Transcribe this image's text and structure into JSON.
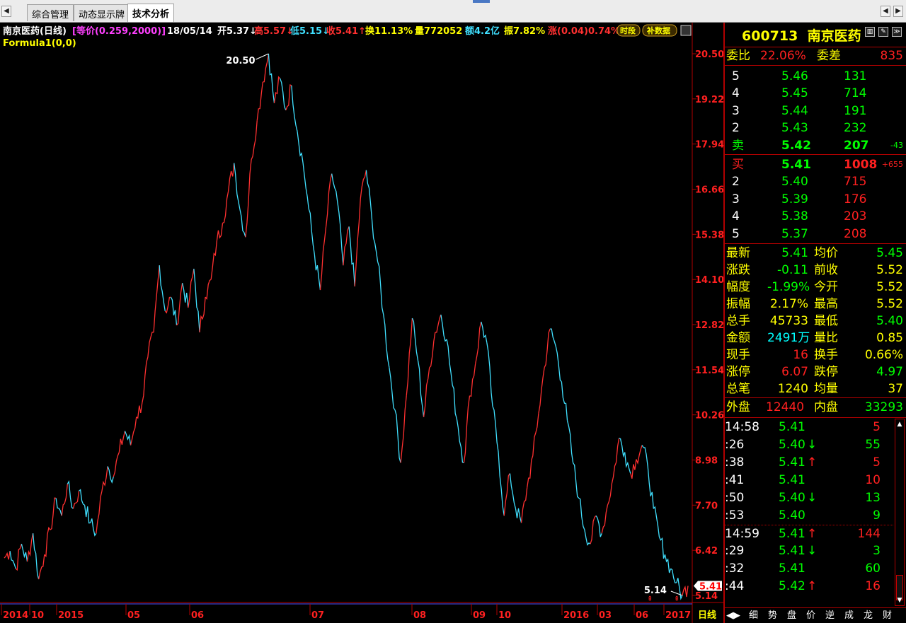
{
  "tabs": {
    "items": [
      "综合管理",
      "动态显示牌",
      "技术分析"
    ],
    "active_index": 2
  },
  "header": {
    "name": "南京医药(日线)",
    "adjust": "[等价(0.259,2000)]",
    "date": "18/05/14",
    "open": "开5.37↓",
    "high": "高5.57↓",
    "low": "低5.15↓",
    "close": "收5.41↑",
    "turnover": "换11.13%",
    "volume": "量772052",
    "amount": "额4.2亿",
    "amplitude": "振7.82%",
    "change": "涨(0.04)0.74%",
    "btn_period": "时段",
    "btn_supp": "补数据"
  },
  "formula": "Formula1(0,0)",
  "period_label": "日线",
  "chart_data": {
    "type": "line",
    "title": "南京医药(日线)",
    "ylim": [
      5.14,
      20.5
    ],
    "y_ticks": [
      "20.50",
      "19.22",
      "17.94",
      "16.66",
      "15.38",
      "14.10",
      "12.82",
      "11.54",
      "10.26",
      "8.98",
      "7.70",
      "6.42",
      "5.14"
    ],
    "x_labels": [
      "2014",
      "10",
      "2015",
      "05",
      "06",
      "07",
      "08",
      "09",
      "10",
      "2016",
      "03",
      "06",
      "2017"
    ],
    "max_label": "20.50",
    "min_label": "5.14",
    "last_label": "5.41",
    "series": [
      {
        "values": [
          6.2,
          6.4,
          5.9,
          6.6,
          6.1,
          6.9,
          5.6,
          6.3,
          7.0,
          7.9,
          7.4,
          8.3,
          7.6,
          8.1,
          7.7,
          7.2,
          6.9,
          8.1,
          8.8,
          8.5,
          9.2,
          9.8,
          9.4,
          10.2,
          10.6,
          11.9,
          12.6,
          14.5,
          13.2,
          13.6,
          12.8,
          14.0,
          13.3,
          14.4,
          12.6,
          13.6,
          14.1,
          15.2,
          15.7,
          16.6,
          17.4,
          16.1,
          15.3,
          17.5,
          18.6,
          19.7,
          20.5,
          19.1,
          19.8,
          18.9,
          19.6,
          18.3,
          17.4,
          16.1,
          14.8,
          13.8,
          15.6,
          17.1,
          16.3,
          14.5,
          15.6,
          13.9,
          16.4,
          17.2,
          15.8,
          14.6,
          13.1,
          11.6,
          10.4,
          8.9,
          10.8,
          13.0,
          11.8,
          10.2,
          11.6,
          12.6,
          13.1,
          12.4,
          11.1,
          9.9,
          8.9,
          10.8,
          11.7,
          12.9,
          12.3,
          10.5,
          9.2,
          7.4,
          8.6,
          7.6,
          7.2,
          8.2,
          9.1,
          10.3,
          11.6,
          12.7,
          12.2,
          11.2,
          10.1,
          8.9,
          7.9,
          7.0,
          6.6,
          7.4,
          6.9,
          7.7,
          8.5,
          9.6,
          9.2,
          8.6,
          9.0,
          9.4,
          8.8,
          7.6,
          6.8,
          6.3,
          5.9,
          5.5,
          5.14,
          5.41
        ]
      }
    ]
  },
  "quote": {
    "code": "600713",
    "name": "南京医药",
    "ratio_label": "委比",
    "ratio_val": "22.06%",
    "diff_label": "委差",
    "diff_val": "835",
    "asks": [
      {
        "lvl": "5",
        "price": "5.46",
        "vol": "131",
        "chg": ""
      },
      {
        "lvl": "4",
        "price": "5.45",
        "vol": "714",
        "chg": ""
      },
      {
        "lvl": "3",
        "price": "5.44",
        "vol": "191",
        "chg": ""
      },
      {
        "lvl": "2",
        "price": "5.43",
        "vol": "232",
        "chg": ""
      },
      {
        "lvl": "卖",
        "price": "5.42",
        "vol": "207",
        "chg": "-43"
      }
    ],
    "bids": [
      {
        "lvl": "买",
        "price": "5.41",
        "vol": "1008",
        "chg": "+655"
      },
      {
        "lvl": "2",
        "price": "5.40",
        "vol": "715",
        "chg": ""
      },
      {
        "lvl": "3",
        "price": "5.39",
        "vol": "176",
        "chg": ""
      },
      {
        "lvl": "4",
        "price": "5.38",
        "vol": "203",
        "chg": ""
      },
      {
        "lvl": "5",
        "price": "5.37",
        "vol": "208",
        "chg": ""
      }
    ],
    "stats": [
      {
        "l1": "最新",
        "v1": "5.41",
        "l2": "均价",
        "v2": "5.45",
        "c1": "#00ff00",
        "c2": "#00ff00"
      },
      {
        "l1": "涨跌",
        "v1": "-0.11",
        "l2": "前收",
        "v2": "5.52",
        "c1": "#00ff00",
        "c2": "#ffff00"
      },
      {
        "l1": "幅度",
        "v1": "-1.99%",
        "l2": "今开",
        "v2": "5.52",
        "c1": "#00ff00",
        "c2": "#ffff00"
      },
      {
        "l1": "振幅",
        "v1": "2.17%",
        "l2": "最高",
        "v2": "5.52",
        "c1": "#ffff00",
        "c2": "#ffff00"
      },
      {
        "l1": "总手",
        "v1": "45733",
        "l2": "最低",
        "v2": "5.40",
        "c1": "#ffff00",
        "c2": "#00ff00"
      },
      {
        "l1": "金额",
        "v1": "2491万",
        "l2": "量比",
        "v2": "0.85",
        "c1": "#00ffff",
        "c2": "#ffff00"
      },
      {
        "l1": "现手",
        "v1": "16",
        "l2": "换手",
        "v2": "0.66%",
        "c1": "#ff2020",
        "c2": "#ffff00"
      },
      {
        "l1": "涨停",
        "v1": "6.07",
        "l2": "跌停",
        "v2": "4.97",
        "c1": "#ff2020",
        "c2": "#00ff00"
      },
      {
        "l1": "总笔",
        "v1": "1240",
        "l2": "均量",
        "v2": "37",
        "c1": "#ffff00",
        "c2": "#ffff00"
      }
    ],
    "outer_label": "外盘",
    "outer_val": "12440",
    "inner_label": "内盘",
    "inner_val": "33293"
  },
  "ticks": [
    {
      "t": "14:58",
      "p": "5.41",
      "a": "",
      "v": "5",
      "vc": "#ff2020"
    },
    {
      "t": ":26",
      "p": "5.40",
      "a": "↓",
      "v": "55",
      "vc": "#00ff00"
    },
    {
      "t": ":38",
      "p": "5.41",
      "a": "↑",
      "v": "5",
      "vc": "#ff2020"
    },
    {
      "t": ":41",
      "p": "5.41",
      "a": "",
      "v": "10",
      "vc": "#ff2020"
    },
    {
      "t": ":50",
      "p": "5.40",
      "a": "↓",
      "v": "13",
      "vc": "#00ff00"
    },
    {
      "t": ":53",
      "p": "5.40",
      "a": "",
      "v": "9",
      "vc": "#00ff00"
    },
    {
      "t": "14:59",
      "p": "5.41",
      "a": "↑",
      "v": "144",
      "vc": "#ff2020"
    },
    {
      "t": ":29",
      "p": "5.41",
      "a": "↓",
      "v": "3",
      "vc": "#00ff00"
    },
    {
      "t": ":32",
      "p": "5.41",
      "a": "",
      "v": "60",
      "vc": "#00ff00"
    },
    {
      "t": ":44",
      "p": "5.42",
      "a": "↑",
      "v": "16",
      "vc": "#ff2020"
    }
  ],
  "bottom_tabs": [
    "细",
    "势",
    "盘",
    "价",
    "逆",
    "成",
    "龙",
    "财"
  ],
  "colors": {
    "up": "#ff2020",
    "down": "#00ff00",
    "line_up": "#ff3030",
    "line_down": "#40e0ff",
    "axis": "#b00000",
    "label": "#ffff00",
    "price": "#00ff00"
  }
}
